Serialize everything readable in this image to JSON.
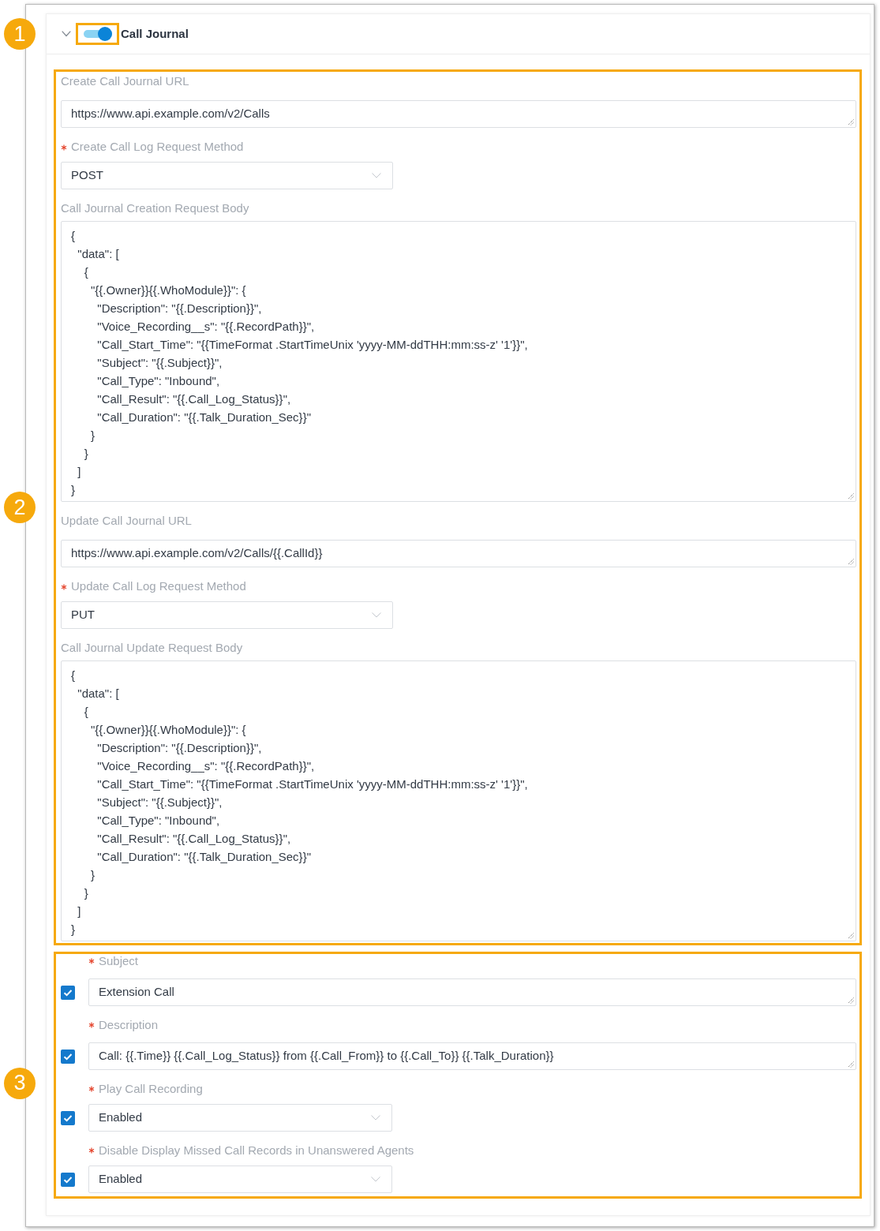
{
  "header": {
    "callout": "1",
    "expanded": true,
    "toggle": {
      "on": true
    },
    "title": "Call Journal"
  },
  "request_section": {
    "callout": "2",
    "fields": [
      {
        "kind": "text",
        "label": "Create Call Journal URL",
        "required": false,
        "value": "https://www.api.example.com/v2/Calls"
      },
      {
        "kind": "select",
        "label": "Create Call Log Request Method",
        "required": true,
        "value": "POST"
      },
      {
        "kind": "code",
        "label": "Call Journal Creation Request Body",
        "required": false,
        "value": "{\n  \"data\": [\n    {\n      \"{{.Owner}}{{.WhoModule}}\": {\n        \"Description\": \"{{.Description}}\",\n        \"Voice_Recording__s\": \"{{.RecordPath}}\",\n        \"Call_Start_Time\": \"{{TimeFormat .StartTimeUnix 'yyyy-MM-ddTHH:mm:ss-z' '1'}}\",\n        \"Subject\": \"{{.Subject}}\",\n        \"Call_Type\": \"Inbound\",\n        \"Call_Result\": \"{{.Call_Log_Status}}\",\n        \"Call_Duration\": \"{{.Talk_Duration_Sec}}\"\n      }\n    }\n  ]\n}"
      },
      {
        "kind": "text",
        "label": "Update Call Journal URL",
        "required": false,
        "value": "https://www.api.example.com/v2/Calls/{{.CallId}}"
      },
      {
        "kind": "select",
        "label": "Update Call Log Request Method",
        "required": true,
        "value": "PUT"
      },
      {
        "kind": "code",
        "label": "Call Journal Update Request Body",
        "required": false,
        "value": "{\n  \"data\": [\n    {\n      \"{{.Owner}}{{.WhoModule}}\": {\n        \"Description\": \"{{.Description}}\",\n        \"Voice_Recording__s\": \"{{.RecordPath}}\",\n        \"Call_Start_Time\": \"{{TimeFormat .StartTimeUnix 'yyyy-MM-ddTHH:mm:ss-z' '1'}}\",\n        \"Subject\": \"{{.Subject}}\",\n        \"Call_Type\": \"Inbound\",\n        \"Call_Result\": \"{{.Call_Log_Status}}\",\n        \"Call_Duration\": \"{{.Talk_Duration_Sec}}\"\n      }\n    }\n  ]\n}"
      }
    ]
  },
  "mapping_section": {
    "callout": "3",
    "fields": [
      {
        "kind": "text",
        "label": "Subject",
        "required": true,
        "checked": true,
        "value": "Extension Call"
      },
      {
        "kind": "text",
        "label": "Description",
        "required": true,
        "checked": true,
        "value": "Call: {{.Time}} {{.Call_Log_Status}} from {{.Call_From}} to {{.Call_To}} {{.Talk_Duration}}"
      },
      {
        "kind": "select",
        "label": "Play Call Recording",
        "required": true,
        "checked": true,
        "value": "Enabled"
      },
      {
        "kind": "select",
        "label": "Disable Display Missed Call Records in Unanswered Agents",
        "required": true,
        "checked": true,
        "value": "Enabled"
      }
    ]
  }
}
